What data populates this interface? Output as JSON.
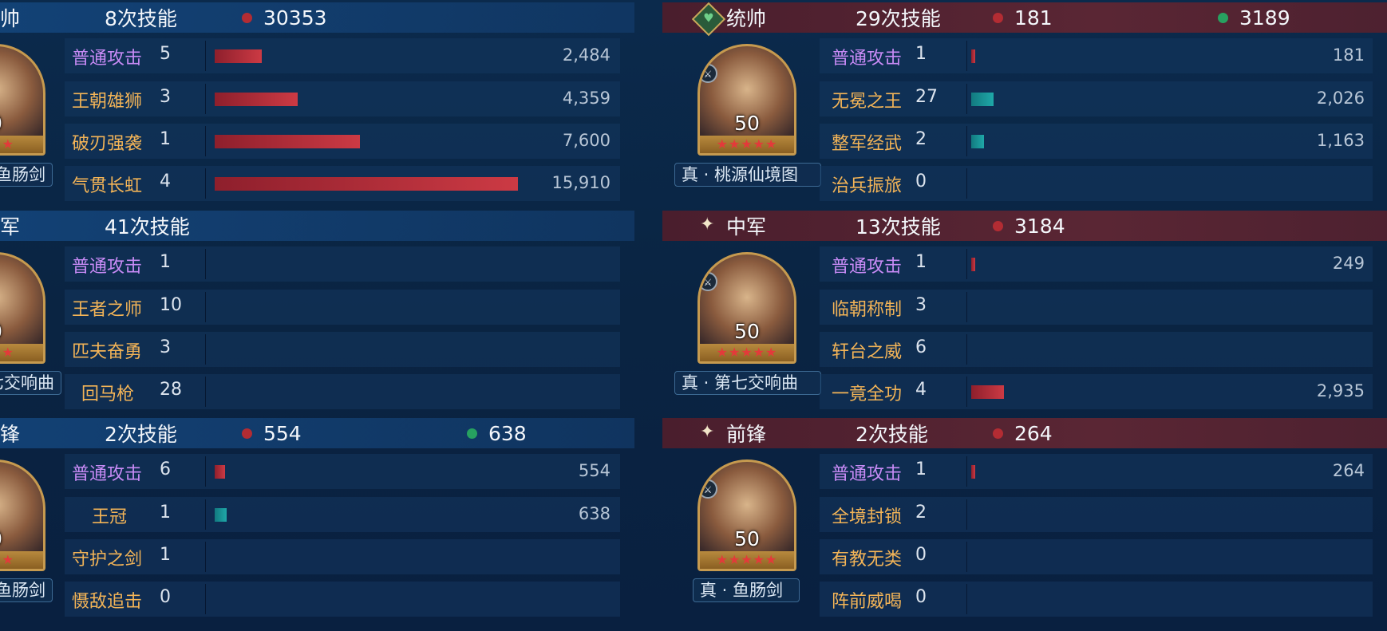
{
  "left_panel": {
    "groups": [
      {
        "role": "帅",
        "count": "8次技能",
        "stat_red": "30353",
        "stat_green": "",
        "portrait": {
          "level": "0",
          "stars": "★★★"
        },
        "weapon": "鱼肠剑",
        "skills": [
          {
            "name": "普通攻击",
            "times": "5",
            "value": "2,484",
            "bar": 0.156,
            "color": "red",
            "type": "basic"
          },
          {
            "name": "王朝雄狮",
            "times": "3",
            "value": "4,359",
            "bar": 0.274,
            "color": "red",
            "type": "skill"
          },
          {
            "name": "破刃强袭",
            "times": "1",
            "value": "7,600",
            "bar": 0.478,
            "color": "red",
            "type": "skill"
          },
          {
            "name": "气贯长虹",
            "times": "4",
            "value": "15,910",
            "bar": 1.0,
            "color": "red",
            "type": "skill"
          }
        ]
      },
      {
        "role": "军",
        "count": "41次技能",
        "stat_red": "",
        "stat_green": "",
        "portrait": {
          "level": "0",
          "stars": "★★★"
        },
        "weapon": "七交响曲",
        "skills": [
          {
            "name": "普通攻击",
            "times": "1",
            "value": "",
            "bar": 0,
            "color": "red",
            "type": "basic"
          },
          {
            "name": "王者之师",
            "times": "10",
            "value": "",
            "bar": 0,
            "color": "red",
            "type": "skill"
          },
          {
            "name": "匹夫奋勇",
            "times": "3",
            "value": "",
            "bar": 0,
            "color": "red",
            "type": "skill"
          },
          {
            "name": "回马枪",
            "times": "28",
            "value": "",
            "bar": 0,
            "color": "red",
            "type": "skill"
          }
        ]
      },
      {
        "role": "锋",
        "count": "2次技能",
        "stat_red": "554",
        "stat_green": "638",
        "portrait": {
          "level": "0",
          "stars": "★★★"
        },
        "weapon": "鱼肠剑",
        "skills": [
          {
            "name": "普通攻击",
            "times": "6",
            "value": "554",
            "bar": 0.035,
            "color": "red",
            "type": "basic"
          },
          {
            "name": "王冠",
            "times": "1",
            "value": "638",
            "bar": 0.04,
            "color": "teal",
            "type": "skill"
          },
          {
            "name": "守护之剑",
            "times": "1",
            "value": "",
            "bar": 0,
            "color": "red",
            "type": "skill"
          },
          {
            "name": "慑敌追击",
            "times": "0",
            "value": "",
            "bar": 0,
            "color": "red",
            "type": "skill"
          }
        ]
      }
    ]
  },
  "right_panel": {
    "groups": [
      {
        "role": "统帅",
        "role_icon": "heart-diamond-icon",
        "count": "29次技能",
        "stat_red": "181",
        "stat_green": "3189",
        "portrait": {
          "level": "50",
          "stars": "★★★★★"
        },
        "weapon": "真 · 桃源仙境图",
        "skills": [
          {
            "name": "普通攻击",
            "times": "1",
            "value": "181",
            "bar": 0.006,
            "color": "red",
            "type": "basic"
          },
          {
            "name": "无冕之王",
            "times": "27",
            "value": "2,026",
            "bar": 0.074,
            "color": "teal",
            "type": "skill"
          },
          {
            "name": "整军经武",
            "times": "2",
            "value": "1,163",
            "bar": 0.042,
            "color": "teal",
            "type": "skill"
          },
          {
            "name": "治兵振旅",
            "times": "0",
            "value": "",
            "bar": 0,
            "color": "red",
            "type": "skill"
          }
        ]
      },
      {
        "role": "中军",
        "role_icon": "sparkle-icon",
        "count": "13次技能",
        "stat_red": "3184",
        "stat_green": "",
        "portrait": {
          "level": "50",
          "stars": "★★★★★"
        },
        "weapon": "真 · 第七交响曲",
        "skills": [
          {
            "name": "普通攻击",
            "times": "1",
            "value": "249",
            "bar": 0.009,
            "color": "red",
            "type": "basic"
          },
          {
            "name": "临朝称制",
            "times": "3",
            "value": "",
            "bar": 0,
            "color": "red",
            "type": "skill"
          },
          {
            "name": "轩台之威",
            "times": "6",
            "value": "",
            "bar": 0,
            "color": "red",
            "type": "skill"
          },
          {
            "name": "一竟全功",
            "times": "4",
            "value": "2,935",
            "bar": 0.107,
            "color": "red",
            "type": "skill"
          }
        ]
      },
      {
        "role": "前锋",
        "role_icon": "sparkle-icon",
        "count": "2次技能",
        "stat_red": "264",
        "stat_green": "",
        "portrait": {
          "level": "50",
          "stars": "★★★★★"
        },
        "weapon": "真 · 鱼肠剑",
        "skills": [
          {
            "name": "普通攻击",
            "times": "1",
            "value": "264",
            "bar": 0.01,
            "color": "red",
            "type": "basic"
          },
          {
            "name": "全境封锁",
            "times": "2",
            "value": "",
            "bar": 0,
            "color": "red",
            "type": "skill"
          },
          {
            "name": "有教无类",
            "times": "0",
            "value": "",
            "bar": 0,
            "color": "red",
            "type": "skill"
          },
          {
            "name": "阵前威喝",
            "times": "0",
            "value": "",
            "bar": 0,
            "color": "red",
            "type": "skill"
          }
        ]
      }
    ]
  }
}
